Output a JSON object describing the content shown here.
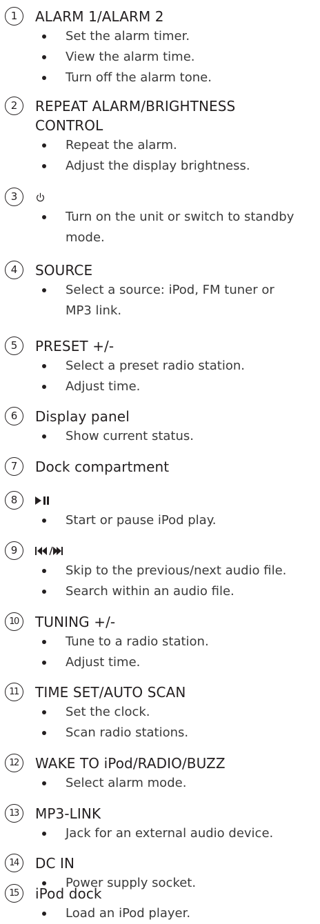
{
  "items": [
    {
      "number": "1",
      "title": "ALARM 1/ALARM 2",
      "bullets": [
        "Set the alarm timer.",
        "View the alarm time.",
        "Turn off the alarm tone."
      ]
    },
    {
      "number": "2",
      "title_line1": "REPEAT ALARM/BRIGHTNESS",
      "title_line2": "CONTROL",
      "bullets": [
        "Repeat the alarm.",
        "Adjust the display brightness."
      ]
    },
    {
      "number": "3",
      "icon": "power-icon",
      "bullets": [
        "Turn on the unit or switch to standby",
        "mode."
      ]
    },
    {
      "number": "4",
      "title": "SOURCE",
      "bullets": [
        "Select a source: iPod, FM tuner or",
        "MP3 link."
      ]
    },
    {
      "number": "5",
      "title": "PRESET +/-",
      "bullets": [
        "Select a preset radio station.",
        "Adjust time."
      ]
    },
    {
      "number": "6",
      "title": "Display panel",
      "bullets": [
        "Show current status."
      ]
    },
    {
      "number": "7",
      "title": "Dock compartment"
    },
    {
      "number": "8",
      "icon": "play-pause-icon",
      "bullets": [
        "Start or pause iPod play."
      ]
    },
    {
      "number": "9",
      "icon": "previous-next-icon",
      "bullets": [
        "Skip to the previous/next audio file.",
        "Search within an audio file."
      ]
    },
    {
      "number": "10",
      "title": "TUNING +/-",
      "bullets": [
        "Tune to a radio station.",
        "Adjust time."
      ]
    },
    {
      "number": "11",
      "title": "TIME SET/AUTO SCAN",
      "bullets": [
        "Set the clock.",
        "Scan radio stations."
      ]
    },
    {
      "number": "12",
      "title": "WAKE TO iPod/RADIO/BUZZ",
      "bullets": [
        "Select alarm mode."
      ]
    },
    {
      "number": "13",
      "title": "MP3-LINK",
      "bullets": [
        "Jack for an external audio device."
      ]
    },
    {
      "number": "14",
      "title": "DC IN",
      "bullets": [
        "Power supply socket."
      ]
    },
    {
      "number": "15",
      "title": "iPod dock",
      "bullets": [
        "Load an iPod player."
      ]
    }
  ]
}
